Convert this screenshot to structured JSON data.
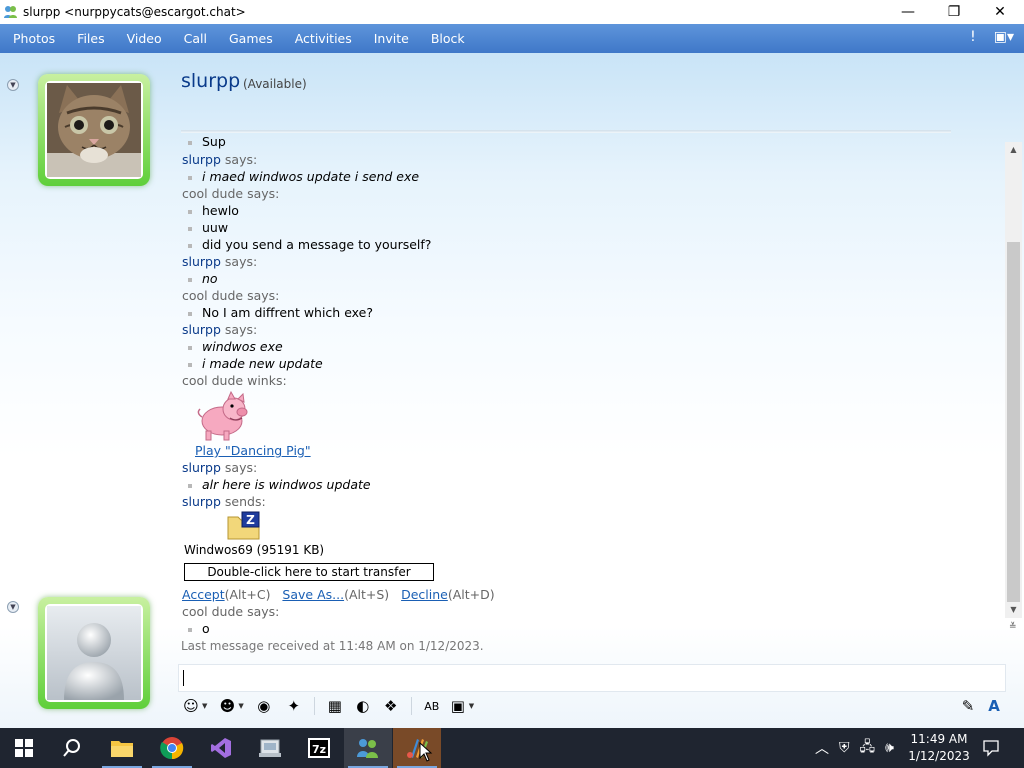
{
  "window": {
    "title": "slurpp <nurppycats@escargot.chat>",
    "minimize_glyph": "—",
    "maximize_glyph": "❐",
    "close_glyph": "✕"
  },
  "menu": [
    "Photos",
    "Files",
    "Video",
    "Call",
    "Games",
    "Activities",
    "Invite",
    "Block"
  ],
  "header": {
    "contact_name": "slurpp",
    "status": "(Available)"
  },
  "conversation": {
    "says": "says:",
    "winks": "winks:",
    "sends": "sends:",
    "me": "cool dude",
    "them": "slurpp",
    "messages": {
      "m0": "Sup",
      "m1": "i maed windwos update i send exe",
      "m2": "hewlo",
      "m3": "uuw",
      "m4": "did you send a message to yourself?",
      "m5": "no",
      "m6": "No I am diffrent which exe?",
      "m7": "windwos exe",
      "m8": "i made new update",
      "m9": "alr here is windwos update",
      "m10": "o"
    },
    "wink_link": "Play \"Dancing Pig\"",
    "file": {
      "name": "Windwos69 (95191 KB)",
      "transfer_prompt": "Double-click here to start transfer",
      "accept": "Accept",
      "accept_key": "(Alt+C)",
      "save_as": "Save As...",
      "save_as_key": "(Alt+S)",
      "decline": "Decline",
      "decline_key": "(Alt+D)"
    },
    "last_received": "Last message received at 11:48 AM on 1/12/2023."
  },
  "taskbar": {
    "time": "11:49 AM",
    "date": "1/12/2023",
    "apps": [
      "start",
      "search",
      "file-explorer",
      "chrome",
      "visual-studio",
      "app-installer",
      "7zip",
      "messenger",
      "paint"
    ]
  },
  "colors": {
    "menu_bar": "#4a84d0",
    "speaker": "#0a3a8a",
    "link": "#1a5fb4",
    "avatar_glow": "#5fcf3a"
  }
}
